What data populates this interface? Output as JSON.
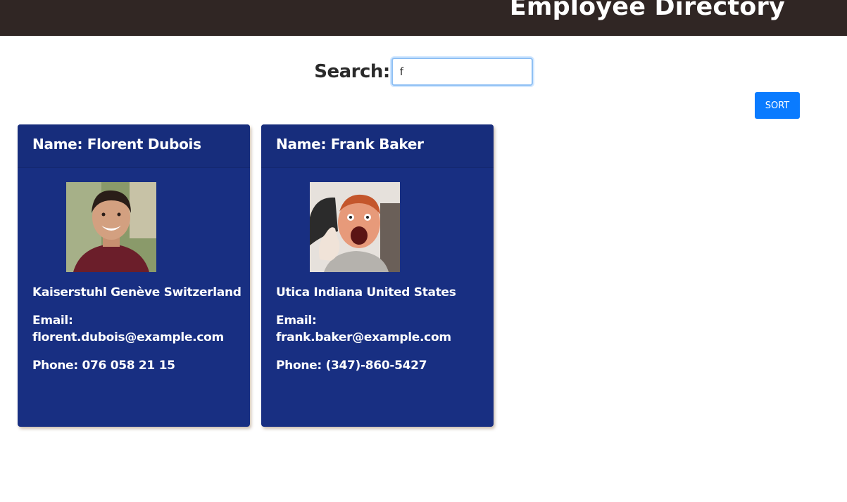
{
  "header": {
    "title": "Employee Directory"
  },
  "search": {
    "label": "Search:",
    "value": "f"
  },
  "toolbar": {
    "sort_label": "SORT"
  },
  "colors": {
    "header_bg": "#302624",
    "card_bg": "#182f82",
    "accent": "#0a7bff"
  },
  "employees": [
    {
      "name": "Name: Florent Dubois",
      "location": "Kaiserstuhl Genève Switzerland",
      "email_label": "Email:",
      "email": "florent.dubois@example.com",
      "phone": "Phone: 076 058 21 15",
      "photo_icon": "person-photo"
    },
    {
      "name": "Name: Frank Baker",
      "location": "Utica Indiana United States",
      "email_label": "Email:",
      "email": "frank.baker@example.com",
      "phone": "Phone: (347)-860-5427",
      "photo_icon": "person-photo"
    }
  ]
}
